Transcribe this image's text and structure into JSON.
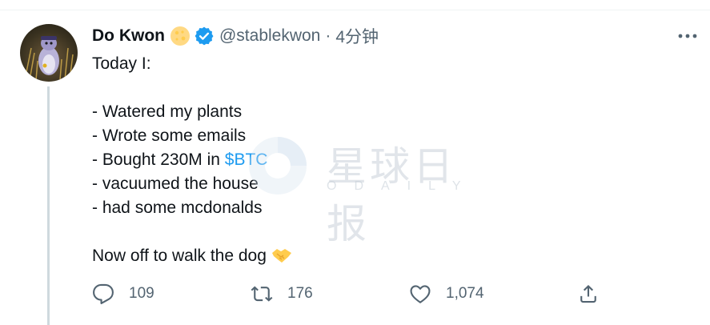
{
  "tweet": {
    "author": {
      "display_name": "Do Kwon",
      "handle": "@stablekwon",
      "verified": true,
      "avatar_icon": "penguin-avatar"
    },
    "separator": "·",
    "timestamp": "4分钟",
    "text_lines": [
      "Today I:",
      "",
      "- Watered my plants",
      "- Wrote some emails",
      "- Bought 230M in ",
      "- vacuumed the house",
      "- had some mcdonalds",
      "",
      "Now off to walk the dog"
    ],
    "cashtag": "$BTC",
    "emoji_handshake": "handshake-emoji",
    "actions": {
      "reply_count": "109",
      "retweet_count": "176",
      "like_count": "1,074"
    }
  },
  "watermark": {
    "main": "星球日报",
    "sub": "ODAILY"
  },
  "colors": {
    "accent": "#1d9bf0",
    "secondary_text": "#536471",
    "thread_line": "#cfd9de"
  }
}
